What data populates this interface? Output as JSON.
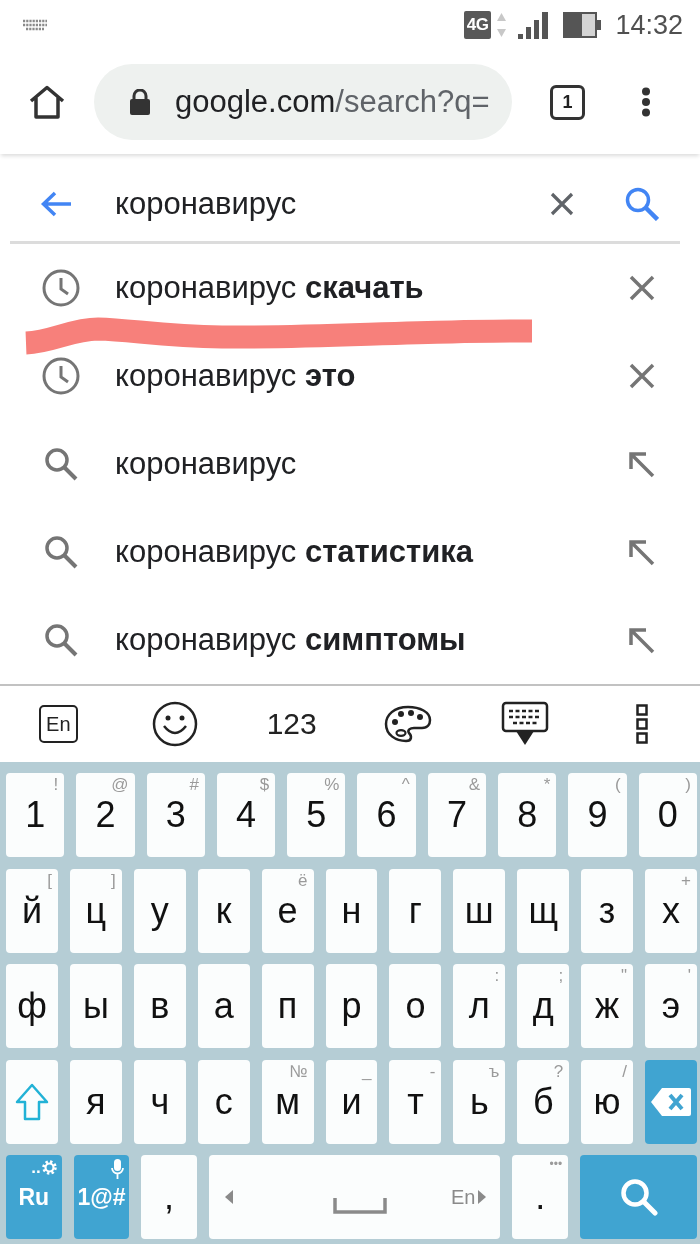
{
  "status_bar": {
    "network": "4G",
    "time": "14:32"
  },
  "browser": {
    "url_host": "google.com",
    "url_path": "/search?q=",
    "tab_count": "1"
  },
  "search": {
    "value": "коронавирус"
  },
  "suggestions": [
    {
      "kind": "history",
      "text": "коронавирус **скачать**"
    },
    {
      "kind": "history",
      "text": "коронавирус **это**"
    },
    {
      "kind": "search",
      "text": "коронавирус"
    },
    {
      "kind": "search",
      "text": "коронавирус **статистика**"
    },
    {
      "kind": "search",
      "text": "коронавирус **симптомы**"
    }
  ],
  "keyboard": {
    "toolbar": [
      {
        "kind": "language",
        "label": "En"
      },
      {
        "kind": "emoji"
      },
      {
        "kind": "numbers",
        "label": "123"
      },
      {
        "kind": "theme"
      },
      {
        "kind": "hide"
      },
      {
        "kind": "more"
      }
    ],
    "rows": [
      {
        "keys": [
          {
            "kind": "char",
            "label": "1",
            "hint": "!"
          },
          {
            "kind": "char",
            "label": "2",
            "hint": "@"
          },
          {
            "kind": "char",
            "label": "3",
            "hint": "#"
          },
          {
            "kind": "char",
            "label": "4",
            "hint": "$"
          },
          {
            "kind": "char",
            "label": "5",
            "hint": "%"
          },
          {
            "kind": "char",
            "label": "6",
            "hint": "^"
          },
          {
            "kind": "char",
            "label": "7",
            "hint": "&"
          },
          {
            "kind": "char",
            "label": "8",
            "hint": "*"
          },
          {
            "kind": "char",
            "label": "9",
            "hint": "("
          },
          {
            "kind": "char",
            "label": "0",
            "hint": ")"
          }
        ]
      },
      {
        "keys": [
          {
            "kind": "char",
            "label": "й",
            "hint": "["
          },
          {
            "kind": "char",
            "label": "ц",
            "hint": "]"
          },
          {
            "kind": "char",
            "label": "у"
          },
          {
            "kind": "char",
            "label": "к"
          },
          {
            "kind": "char",
            "label": "е",
            "hint": "ё"
          },
          {
            "kind": "char",
            "label": "н"
          },
          {
            "kind": "char",
            "label": "г"
          },
          {
            "kind": "char",
            "label": "ш"
          },
          {
            "kind": "char",
            "label": "щ"
          },
          {
            "kind": "char",
            "label": "з"
          },
          {
            "kind": "char",
            "label": "х",
            "hint": "+"
          }
        ]
      },
      {
        "keys": [
          {
            "kind": "char",
            "label": "ф"
          },
          {
            "kind": "char",
            "label": "ы"
          },
          {
            "kind": "char",
            "label": "в"
          },
          {
            "kind": "char",
            "label": "а"
          },
          {
            "kind": "char",
            "label": "п"
          },
          {
            "kind": "char",
            "label": "р"
          },
          {
            "kind": "char",
            "label": "о"
          },
          {
            "kind": "char",
            "label": "л",
            "hint": ":"
          },
          {
            "kind": "char",
            "label": "д",
            "hint": ";"
          },
          {
            "kind": "char",
            "label": "ж",
            "hint": "\""
          },
          {
            "kind": "char",
            "label": "э",
            "hint": "'"
          }
        ]
      },
      {
        "keys": [
          {
            "kind": "shift"
          },
          {
            "kind": "char",
            "label": "я"
          },
          {
            "kind": "char",
            "label": "ч"
          },
          {
            "kind": "char",
            "label": "с"
          },
          {
            "kind": "char",
            "label": "м",
            "hint": "№"
          },
          {
            "kind": "char",
            "label": "и",
            "hint": "_"
          },
          {
            "kind": "char",
            "label": "т",
            "hint": "-"
          },
          {
            "kind": "char",
            "label": "ь",
            "hint": "ъ"
          },
          {
            "kind": "char",
            "label": "б",
            "hint": "?"
          },
          {
            "kind": "char",
            "label": "ю",
            "hint": "/"
          },
          {
            "kind": "backspace"
          }
        ]
      },
      {
        "keys": [
          {
            "kind": "language",
            "label": "Ru",
            "hint": ".."
          },
          {
            "kind": "symbols",
            "label": "1@#"
          },
          {
            "kind": "char",
            "label": ","
          },
          {
            "kind": "space",
            "label": "En"
          },
          {
            "kind": "char",
            "label": ".",
            "hint": "•••"
          },
          {
            "kind": "search"
          }
        ]
      }
    ]
  }
}
